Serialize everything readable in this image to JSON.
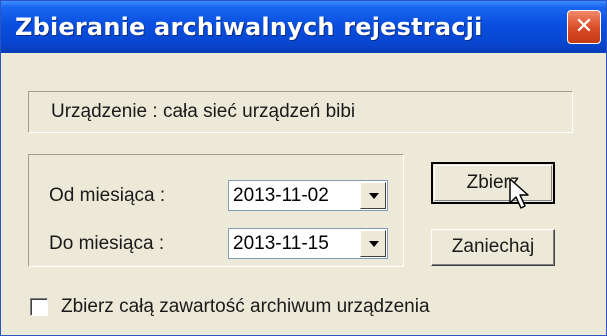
{
  "window": {
    "title": "Zbieranie archiwalnych rejestracji"
  },
  "device": {
    "text": "Urządzenie : cała sieć urządzeń bibi"
  },
  "range": {
    "from_label": "Od miesiąca :",
    "from_value": "2013-11-02",
    "to_label": "Do miesiąca :",
    "to_value": "2013-11-15"
  },
  "buttons": {
    "collect": "Zbierz",
    "cancel": "Zaniechaj"
  },
  "checkbox": {
    "label": "Zbierz całą zawartość archiwum urządzenia",
    "checked": false
  },
  "icons": {
    "close": "close-icon",
    "dropdown": "chevron-down-icon",
    "cursor": "mouse-pointer-icon"
  },
  "colors": {
    "titlebar": "#0a4fe0",
    "close_button": "#d94b26",
    "dialog_bg": "#ece9d8"
  }
}
